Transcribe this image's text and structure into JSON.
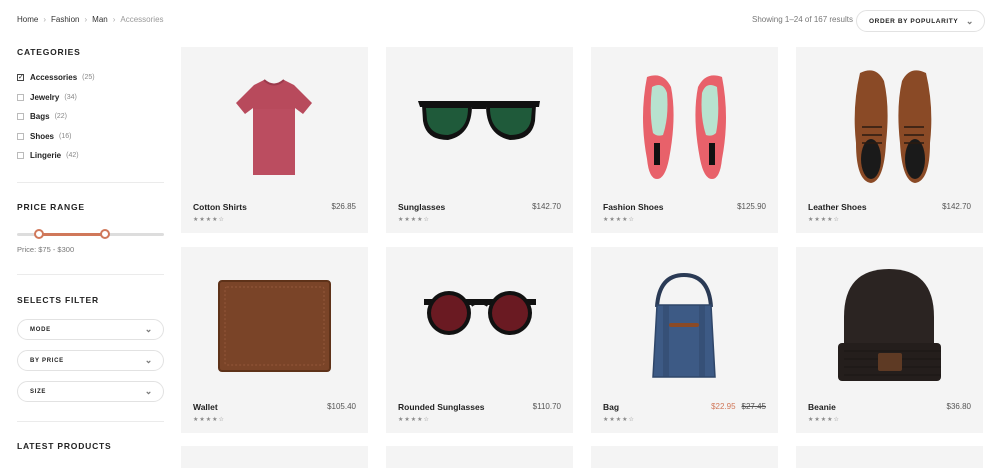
{
  "breadcrumb": [
    {
      "label": "Home"
    },
    {
      "label": "Fashion"
    },
    {
      "label": "Man"
    },
    {
      "label": "Accessories"
    }
  ],
  "results": "Showing 1–24 of 167 results",
  "sort": {
    "label": "ORDER BY POPULARITY"
  },
  "sidebar": {
    "categories_title": "CATEGORIES",
    "categories": [
      {
        "label": "Accessories",
        "count": "(25)",
        "checked": true
      },
      {
        "label": "Jewelry",
        "count": "(34)",
        "checked": false
      },
      {
        "label": "Bags",
        "count": "(22)",
        "checked": false
      },
      {
        "label": "Shoes",
        "count": "(16)",
        "checked": false
      },
      {
        "label": "Lingerie",
        "count": "(42)",
        "checked": false
      }
    ],
    "price_title": "PRICE RANGE",
    "price_text": "Price: $75 - $300",
    "price_range": {
      "min": 75,
      "max": 300
    },
    "filter_title": "SELECTS FILTER",
    "filters": [
      {
        "label": "MODE"
      },
      {
        "label": "BY PRICE"
      },
      {
        "label": "SIZE"
      }
    ],
    "latest_title": "LATEST PRODUCTS"
  },
  "accent_color": "#d0785a",
  "products": [
    {
      "name": "Cotton Shirts",
      "price": "$26.85",
      "stars": "★★★★☆",
      "icon": "tshirt-image"
    },
    {
      "name": "Sunglasses",
      "price": "$142.70",
      "stars": "★★★★☆",
      "icon": "sunglasses-image"
    },
    {
      "name": "Fashion Shoes",
      "price": "$125.90",
      "stars": "★★★★☆",
      "icon": "heels-image"
    },
    {
      "name": "Leather Shoes",
      "price": "$142.70",
      "stars": "★★★★☆",
      "icon": "oxford-shoes-image"
    },
    {
      "name": "Wallet",
      "price": "$105.40",
      "stars": "★★★★☆",
      "icon": "wallet-image"
    },
    {
      "name": "Rounded Sunglasses",
      "price": "$110.70",
      "stars": "★★★★☆",
      "icon": "round-sunglasses-image"
    },
    {
      "name": "Bag",
      "sale_price": "$22.95",
      "old_price": "$27.45",
      "stars": "★★★★☆",
      "icon": "tote-bag-image"
    },
    {
      "name": "Beanie",
      "price": "$36.80",
      "stars": "★★★★☆",
      "icon": "beanie-image"
    }
  ]
}
